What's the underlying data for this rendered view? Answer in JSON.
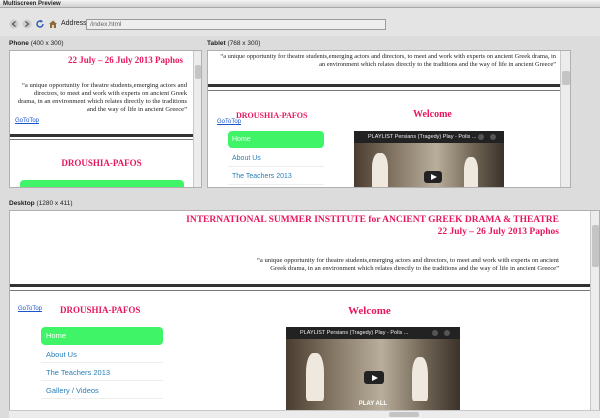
{
  "window": {
    "title": "Multiscreen Preview"
  },
  "toolbar": {
    "back_icon": "back-arrow-icon",
    "forward_icon": "forward-arrow-icon",
    "refresh_icon": "refresh-icon",
    "home_icon": "home-icon",
    "address_label": "Address:",
    "address_value": "/index.html"
  },
  "panes": {
    "phone": {
      "name": "Phone",
      "dims": "(400 x 300)"
    },
    "tablet": {
      "name": "Tablet",
      "dims": "(768 x 300)"
    },
    "desktop": {
      "name": "Desktop",
      "dims": "(1280 x 411)"
    }
  },
  "site": {
    "institute_title": "INTERNATIONAL SUMMER INSTITUTE for ANCIENT GREEK DRAMA & THEATRE",
    "dates": "22 July – 26 July 2013 Paphos",
    "quote_phone": "“a unique opportunity for theatre students,emerging actors and directors, to meet and work with experts on ancient Greek drama, in an environment which relates directly to the traditions and the way of life in ancient Greece”",
    "quote_tablet": "“a unique opportunity for theatre students,emerging actors and directors, to meet and work with experts on ancient Greek drama, in an environment which relates directly to the traditions and the way of life in ancient Greece”",
    "quote_desktop": "“a unique opportunity for theatre students,emerging actors and directors, to meet and work with experts on ancient Greek drama, in an environment which relates directly to the traditions and the way of life in ancient Greece”",
    "go_to_top": "GoToTop",
    "brand": "DROUSHIA-PAFOS",
    "welcome": "Welcome",
    "menu": {
      "home": "Home",
      "about": "About Us",
      "teachers": "The Teachers 2013",
      "gallery": "Gallery / Videos"
    },
    "video": {
      "title": "PLAYLIST  Persians (Tragedy) Play - Polis ...",
      "play_all": "PLAY ALL"
    }
  }
}
